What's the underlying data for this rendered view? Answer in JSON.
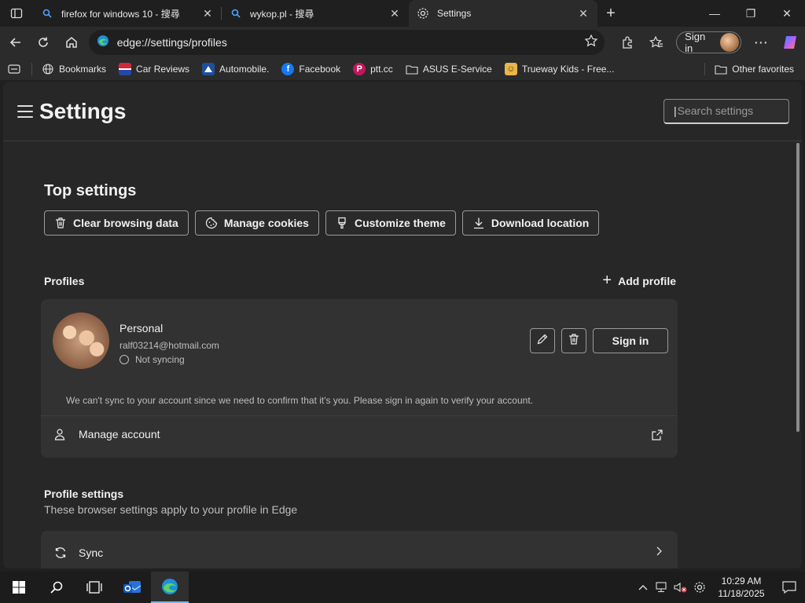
{
  "tabs": [
    {
      "title": "firefox for windows 10 - 搜尋",
      "icon": "search-icon"
    },
    {
      "title": "wykop.pl - 搜尋",
      "icon": "search-icon"
    },
    {
      "title": "Settings",
      "icon": "gear-icon",
      "active": true
    }
  ],
  "address_bar": {
    "url": "edge://settings/profiles",
    "sign_in_label": "Sign in"
  },
  "favorites": [
    {
      "label": "Bookmarks",
      "icon": "globe-icon"
    },
    {
      "label": "Car Reviews",
      "icon": "flag-icon"
    },
    {
      "label": "Automobile.",
      "icon": "triangle-icon"
    },
    {
      "label": "Facebook",
      "icon": "facebook-icon"
    },
    {
      "label": "ptt.cc",
      "icon": "p-icon"
    },
    {
      "label": "ASUS E-Service",
      "icon": "folder-icon"
    },
    {
      "label": "Trueway Kids - Free...",
      "icon": "kids-icon"
    }
  ],
  "other_favorites": "Other favorites",
  "settings": {
    "title": "Settings",
    "search_placeholder": "Search settings",
    "top_settings_heading": "Top settings",
    "quick_actions": [
      {
        "label": "Clear browsing data",
        "icon": "trash-icon"
      },
      {
        "label": "Manage cookies",
        "icon": "cookie-icon"
      },
      {
        "label": "Customize theme",
        "icon": "brush-icon"
      },
      {
        "label": "Download location",
        "icon": "download-icon"
      }
    ],
    "profiles_heading": "Profiles",
    "add_profile_label": "Add profile",
    "profile": {
      "name": "Personal",
      "email": "ralf03214@hotmail.com",
      "sync_status": "Not syncing",
      "sign_in_label": "Sign in",
      "message": "We can't sync to your account since we need to confirm that it's you. Please sign in again to verify your account.",
      "manage_account_label": "Manage account"
    },
    "profile_settings_heading": "Profile settings",
    "profile_settings_sub": "These browser settings apply to your profile in Edge",
    "sync_label": "Sync"
  },
  "taskbar": {
    "time": "10:29 AM",
    "date": "11/18/2025"
  }
}
